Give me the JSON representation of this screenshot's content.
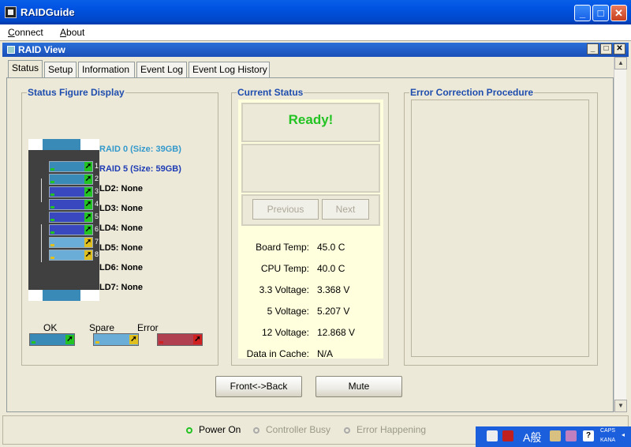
{
  "window": {
    "title": "RAIDGuide",
    "min": "_",
    "max": "□",
    "close": "✕"
  },
  "menu": {
    "connect": "Connect",
    "about": "About"
  },
  "inner_window": {
    "title": "RAID View",
    "min": "_",
    "max": "□",
    "close": "✕"
  },
  "tabs": [
    "Status",
    "Setup",
    "Information",
    "Event Log",
    "Event Log History"
  ],
  "groups": {
    "status_figure": "Status Figure Display",
    "current_status": "Current Status",
    "error_correction": "Error Correction Procedure"
  },
  "drives": [
    {
      "num": "1",
      "state": "ok"
    },
    {
      "num": "2",
      "state": "ok"
    },
    {
      "num": "3",
      "state": "ok"
    },
    {
      "num": "4",
      "state": "ok"
    },
    {
      "num": "5",
      "state": "ok"
    },
    {
      "num": "6",
      "state": "ok"
    },
    {
      "num": "7",
      "state": "spare"
    },
    {
      "num": "8",
      "state": "spare"
    }
  ],
  "logical_drives": [
    {
      "label": "RAID 0 (Size: 39GB)",
      "color": "#3399CC"
    },
    {
      "label": "RAID 5 (Size: 59GB)",
      "color": "#1E3CB4"
    },
    {
      "label": "LD2: None",
      "color": "#000000"
    },
    {
      "label": "LD3: None",
      "color": "#000000"
    },
    {
      "label": "LD4: None",
      "color": "#000000"
    },
    {
      "label": "LD5: None",
      "color": "#000000"
    },
    {
      "label": "LD6: None",
      "color": "#000000"
    },
    {
      "label": "LD7: None",
      "color": "#000000"
    }
  ],
  "legend": {
    "ok": "OK",
    "spare": "Spare",
    "error": "Error"
  },
  "status": {
    "message": "Ready!",
    "previous": "Previous",
    "next": "Next",
    "readings": [
      {
        "label": "Board Temp:",
        "value": "45.0 C"
      },
      {
        "label": "CPU Temp:",
        "value": "40.0 C"
      },
      {
        "label": "3.3 Voltage:",
        "value": "3.368 V"
      },
      {
        "label": "5 Voltage:",
        "value": "5.207 V"
      },
      {
        "label": "12 Voltage:",
        "value": "12.868 V"
      },
      {
        "label": "Data in Cache:",
        "value": "N/A"
      }
    ]
  },
  "buttons": {
    "front_back": "Front<->Back",
    "mute": "Mute"
  },
  "indicators": [
    {
      "label": "Power On",
      "active": true
    },
    {
      "label": "Controller Busy",
      "active": false
    },
    {
      "label": "Error Happening",
      "active": false
    }
  ],
  "tray": {
    "ime": "A般",
    "caps": "CAPS",
    "kana": "KANA"
  },
  "colors": {
    "ok_drive": "#3A8AB8",
    "ok_drive_alt": "#3A48C0",
    "spare_drive": "#6AAED8",
    "error_drive": "#B04050",
    "ok_led": "#22C322",
    "spare_led": "#E0C020",
    "error_led": "#D02020"
  }
}
